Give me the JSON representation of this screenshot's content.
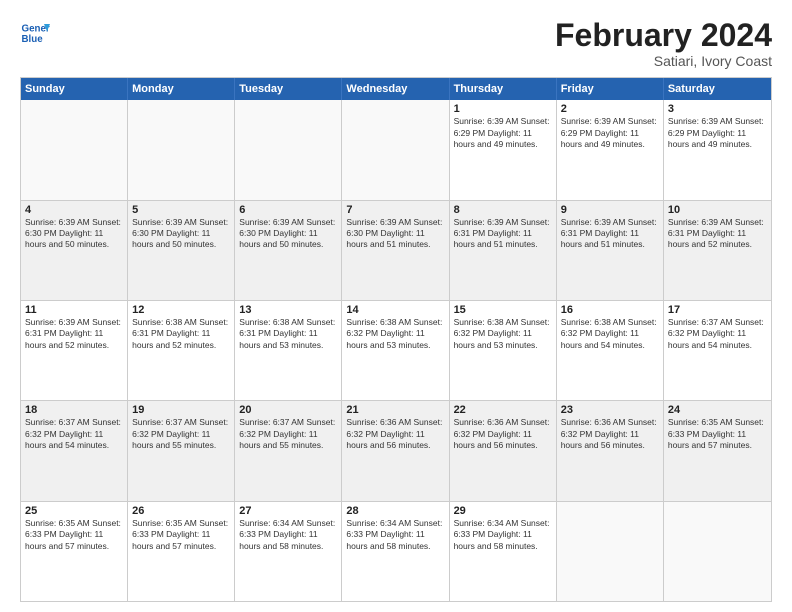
{
  "header": {
    "logo_line1": "General",
    "logo_line2": "Blue",
    "month_title": "February 2024",
    "subtitle": "Satiari, Ivory Coast"
  },
  "weekdays": [
    "Sunday",
    "Monday",
    "Tuesday",
    "Wednesday",
    "Thursday",
    "Friday",
    "Saturday"
  ],
  "rows": [
    [
      {
        "day": "",
        "info": "",
        "empty": true
      },
      {
        "day": "",
        "info": "",
        "empty": true
      },
      {
        "day": "",
        "info": "",
        "empty": true
      },
      {
        "day": "",
        "info": "",
        "empty": true
      },
      {
        "day": "1",
        "info": "Sunrise: 6:39 AM\nSunset: 6:29 PM\nDaylight: 11 hours\nand 49 minutes."
      },
      {
        "day": "2",
        "info": "Sunrise: 6:39 AM\nSunset: 6:29 PM\nDaylight: 11 hours\nand 49 minutes."
      },
      {
        "day": "3",
        "info": "Sunrise: 6:39 AM\nSunset: 6:29 PM\nDaylight: 11 hours\nand 49 minutes."
      }
    ],
    [
      {
        "day": "4",
        "info": "Sunrise: 6:39 AM\nSunset: 6:30 PM\nDaylight: 11 hours\nand 50 minutes."
      },
      {
        "day": "5",
        "info": "Sunrise: 6:39 AM\nSunset: 6:30 PM\nDaylight: 11 hours\nand 50 minutes."
      },
      {
        "day": "6",
        "info": "Sunrise: 6:39 AM\nSunset: 6:30 PM\nDaylight: 11 hours\nand 50 minutes."
      },
      {
        "day": "7",
        "info": "Sunrise: 6:39 AM\nSunset: 6:30 PM\nDaylight: 11 hours\nand 51 minutes."
      },
      {
        "day": "8",
        "info": "Sunrise: 6:39 AM\nSunset: 6:31 PM\nDaylight: 11 hours\nand 51 minutes."
      },
      {
        "day": "9",
        "info": "Sunrise: 6:39 AM\nSunset: 6:31 PM\nDaylight: 11 hours\nand 51 minutes."
      },
      {
        "day": "10",
        "info": "Sunrise: 6:39 AM\nSunset: 6:31 PM\nDaylight: 11 hours\nand 52 minutes."
      }
    ],
    [
      {
        "day": "11",
        "info": "Sunrise: 6:39 AM\nSunset: 6:31 PM\nDaylight: 11 hours\nand 52 minutes."
      },
      {
        "day": "12",
        "info": "Sunrise: 6:38 AM\nSunset: 6:31 PM\nDaylight: 11 hours\nand 52 minutes."
      },
      {
        "day": "13",
        "info": "Sunrise: 6:38 AM\nSunset: 6:31 PM\nDaylight: 11 hours\nand 53 minutes."
      },
      {
        "day": "14",
        "info": "Sunrise: 6:38 AM\nSunset: 6:32 PM\nDaylight: 11 hours\nand 53 minutes."
      },
      {
        "day": "15",
        "info": "Sunrise: 6:38 AM\nSunset: 6:32 PM\nDaylight: 11 hours\nand 53 minutes."
      },
      {
        "day": "16",
        "info": "Sunrise: 6:38 AM\nSunset: 6:32 PM\nDaylight: 11 hours\nand 54 minutes."
      },
      {
        "day": "17",
        "info": "Sunrise: 6:37 AM\nSunset: 6:32 PM\nDaylight: 11 hours\nand 54 minutes."
      }
    ],
    [
      {
        "day": "18",
        "info": "Sunrise: 6:37 AM\nSunset: 6:32 PM\nDaylight: 11 hours\nand 54 minutes."
      },
      {
        "day": "19",
        "info": "Sunrise: 6:37 AM\nSunset: 6:32 PM\nDaylight: 11 hours\nand 55 minutes."
      },
      {
        "day": "20",
        "info": "Sunrise: 6:37 AM\nSunset: 6:32 PM\nDaylight: 11 hours\nand 55 minutes."
      },
      {
        "day": "21",
        "info": "Sunrise: 6:36 AM\nSunset: 6:32 PM\nDaylight: 11 hours\nand 56 minutes."
      },
      {
        "day": "22",
        "info": "Sunrise: 6:36 AM\nSunset: 6:32 PM\nDaylight: 11 hours\nand 56 minutes."
      },
      {
        "day": "23",
        "info": "Sunrise: 6:36 AM\nSunset: 6:32 PM\nDaylight: 11 hours\nand 56 minutes."
      },
      {
        "day": "24",
        "info": "Sunrise: 6:35 AM\nSunset: 6:33 PM\nDaylight: 11 hours\nand 57 minutes."
      }
    ],
    [
      {
        "day": "25",
        "info": "Sunrise: 6:35 AM\nSunset: 6:33 PM\nDaylight: 11 hours\nand 57 minutes."
      },
      {
        "day": "26",
        "info": "Sunrise: 6:35 AM\nSunset: 6:33 PM\nDaylight: 11 hours\nand 57 minutes."
      },
      {
        "day": "27",
        "info": "Sunrise: 6:34 AM\nSunset: 6:33 PM\nDaylight: 11 hours\nand 58 minutes."
      },
      {
        "day": "28",
        "info": "Sunrise: 6:34 AM\nSunset: 6:33 PM\nDaylight: 11 hours\nand 58 minutes."
      },
      {
        "day": "29",
        "info": "Sunrise: 6:34 AM\nSunset: 6:33 PM\nDaylight: 11 hours\nand 58 minutes."
      },
      {
        "day": "",
        "info": "",
        "empty": true
      },
      {
        "day": "",
        "info": "",
        "empty": true
      }
    ]
  ]
}
